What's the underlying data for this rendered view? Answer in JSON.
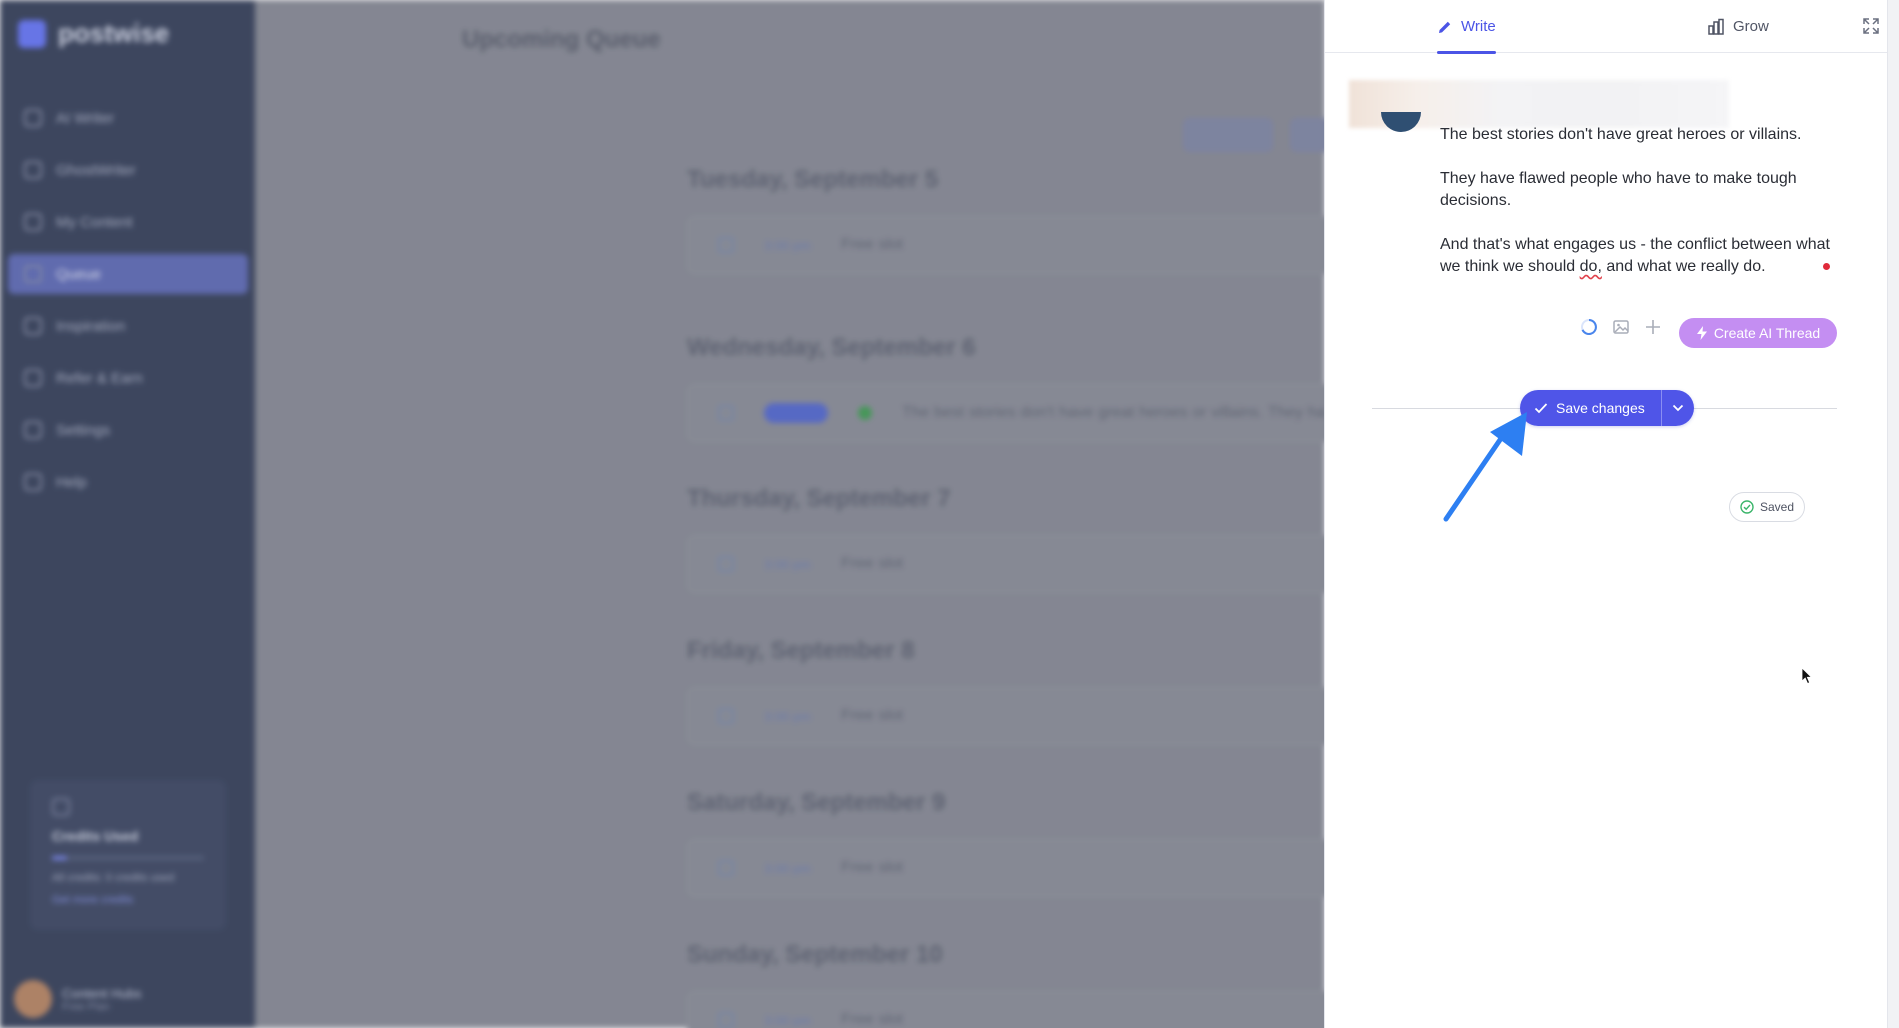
{
  "background_app": {
    "logo": "postwise",
    "nav_items": [
      "AI Writer",
      "GhostWriter",
      "My Content",
      "Queue",
      "Inspiration",
      "Refer & Earn",
      "Settings",
      "Help"
    ],
    "active_nav": "Queue",
    "page_title": "Upcoming Queue",
    "filter_buttons": [
      "Filters",
      "Sort"
    ],
    "days": [
      {
        "title": "Tuesday, September 5",
        "time": "3:00 pm",
        "text": "Free slot"
      },
      {
        "title": "Wednesday, September 6",
        "time": "",
        "text": "The best stories don't have great heroes or villains. They ha"
      },
      {
        "title": "Thursday, September 7",
        "time": "3:00 pm",
        "text": "Free slot"
      },
      {
        "title": "Friday, September 8",
        "time": "3:00 pm",
        "text": "Free slot"
      },
      {
        "title": "Saturday, September 9",
        "time": "3:00 pm",
        "text": "Free slot"
      },
      {
        "title": "Sunday, September 10",
        "time": "3:00 pm",
        "text": "Free slot"
      }
    ],
    "credits": {
      "title": "Credits Used",
      "used_fraction": 0.1,
      "line": "All credits: 0 credits used",
      "link": "Get more credits"
    },
    "user": {
      "name": "Content Hubs",
      "subtitle": "Free Plan"
    }
  },
  "panel": {
    "tabs": {
      "write": "Write",
      "grow": "Grow"
    },
    "post_paragraphs": [
      "The best stories don't have great heroes or villains.",
      "They have flawed people who have to make tough decisions."
    ],
    "post_last": {
      "before": "And that's what engages us - the conflict between what we think we should ",
      "misspelled": "do,",
      "after": " and what we really do."
    },
    "ai_button": "Create AI Thread",
    "save_button": "Save changes",
    "saved_badge": "Saved"
  },
  "colors": {
    "accent": "#4f55e8",
    "ai_button": "#c48ef2",
    "arrow": "#2d7ff2",
    "status_dot": "#e02a3a",
    "saved_check": "#3bb56a"
  }
}
